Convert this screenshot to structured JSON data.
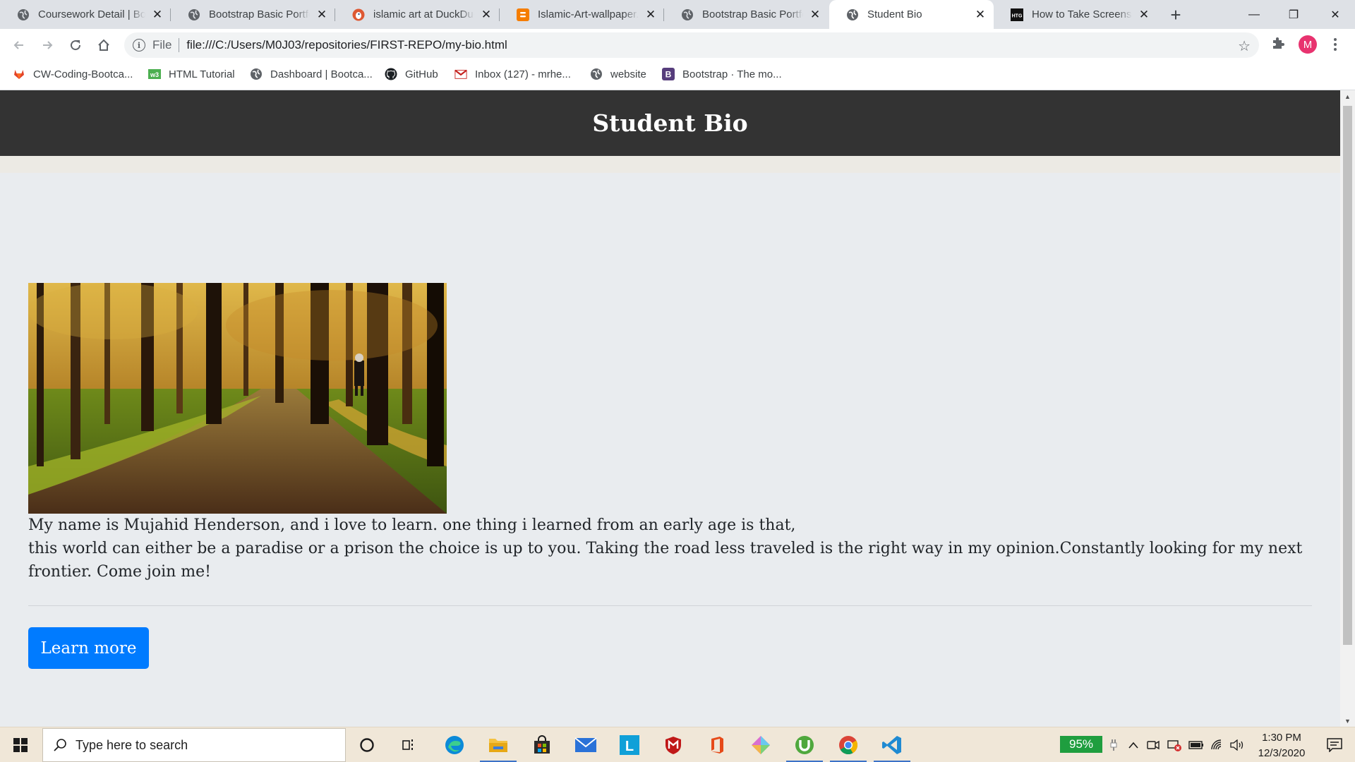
{
  "browser": {
    "tabs": [
      {
        "title": "Coursework Detail | Bo",
        "favicon": "globe-icon",
        "active": false
      },
      {
        "title": "Bootstrap Basic Portfoli",
        "favicon": "globe-icon",
        "active": false
      },
      {
        "title": "islamic art at DuckDuck",
        "favicon": "duckduckgo-icon",
        "active": false
      },
      {
        "title": "Islamic-Art-wallpaper.jp",
        "favicon": "blogger-icon",
        "active": false
      },
      {
        "title": "Bootstrap Basic Portfoli",
        "favicon": "globe-icon",
        "active": false
      },
      {
        "title": "Student Bio",
        "favicon": "globe-icon",
        "active": true
      },
      {
        "title": "How to Take Screensho",
        "favicon": "htg-icon",
        "active": false
      }
    ],
    "htg_label": "HTG",
    "new_tab": "+",
    "window_controls": {
      "minimize": "—",
      "restore": "❐",
      "close": "✕"
    },
    "omnibox": {
      "scheme_label": "File",
      "url": "file:///C:/Users/M0J03/repositories/FIRST-REPO/my-bio.html"
    },
    "profile_initial": "M",
    "bookmarks": [
      {
        "label": "CW-Coding-Bootca...",
        "icon": "gitlab-icon"
      },
      {
        "label": "HTML Tutorial",
        "icon": "w3schools-icon"
      },
      {
        "label": "Dashboard | Bootca...",
        "icon": "globe-icon"
      },
      {
        "label": "GitHub",
        "icon": "github-icon"
      },
      {
        "label": "Inbox (127) - mrhe...",
        "icon": "gmail-icon"
      },
      {
        "label": "website",
        "icon": "globe-icon"
      },
      {
        "label": "Bootstrap · The mo...",
        "icon": "bootstrap-icon"
      }
    ],
    "w3_label": "w3",
    "bootstrap_letter": "B"
  },
  "page": {
    "header_title": "Student Bio",
    "bio_line1": "My name is Mujahid Henderson, and i love to learn. one thing i learned from an early age is that,",
    "bio_line2": "this world can either be a paradise or a prison the choice is up to you. Taking the road less traveled is the right way in my opinion.Constantly looking for my next frontier. Come join me!",
    "button_label": "Learn more",
    "colors": {
      "header_bg": "#333333",
      "page_bg": "#e9ecef",
      "button_bg": "#007bff"
    }
  },
  "taskbar": {
    "search_placeholder": "Type here to search",
    "apps": [
      "cortana-icon",
      "task-view-icon",
      "edge-icon",
      "file-explorer-icon",
      "store-icon",
      "mail-icon",
      "app-l-icon",
      "mcafee-icon",
      "office-icon",
      "app-diamond-icon",
      "utorrent-icon",
      "chrome-icon",
      "vscode-icon"
    ],
    "app_l_letter": "L",
    "battery_percent": "95%",
    "time": "1:30 PM",
    "date": "12/3/2020"
  }
}
